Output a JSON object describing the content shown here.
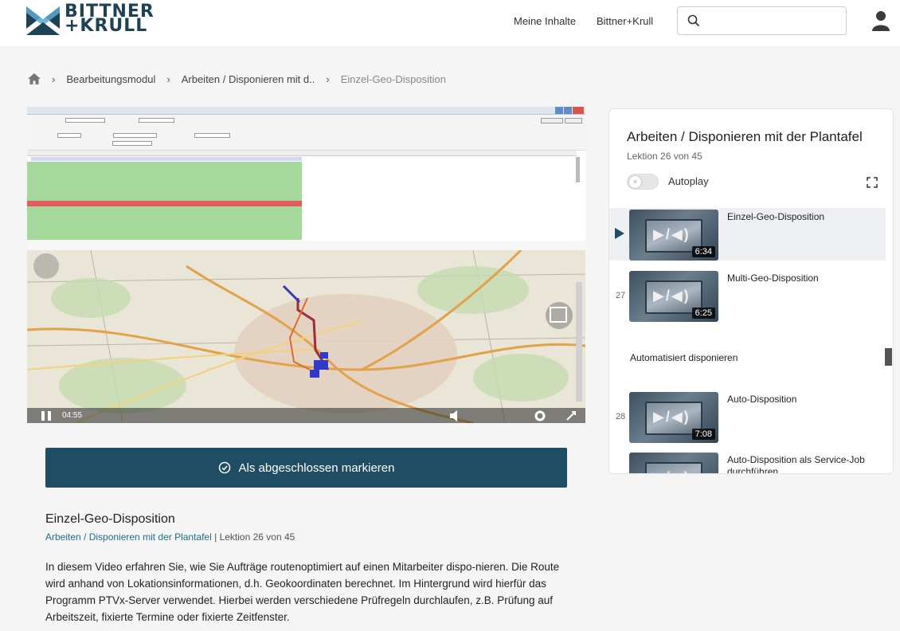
{
  "brand": {
    "line1": "BITTNER",
    "line2": "+KRULL"
  },
  "nav": {
    "link1": "Meine Inhalte",
    "link2": "Bittner+Krull"
  },
  "search": {
    "placeholder": ""
  },
  "breadcrumb": {
    "items": [
      "Bearbeitungsmodul",
      "Arbeiten / Disponieren mit d..",
      "Einzel-Geo-Disposition"
    ]
  },
  "video": {
    "current_time": "04:55"
  },
  "complete_button": {
    "label": "Als abgeschlossen markieren"
  },
  "info": {
    "title": "Einzel-Geo-Disposition",
    "course_link": "Arbeiten / Disponieren mit der Plantafel",
    "lesson": "Lektion 26 von 45",
    "description": "In diesem Video erfahren Sie, wie Sie Aufträge routenoptimiert auf einen Mitarbeiter dispo-nieren. Die Route wird anhand von Lokationsinformationen, d.h. Geokoordinaten berechnet. Im Hintergrund wird hierfür das Programm PTVx-Server verwendet. Hierbei werden verschiedene Prüfregeln durchlaufen, z.B. Prüfung auf Arbeitszeit, fixierte Termine oder fixierte Zeitfenster."
  },
  "panel": {
    "title": "Arbeiten / Disponieren mit der Plantafel",
    "lesson": "Lektion 26 von 45",
    "autoplay_label": "Autoplay",
    "toggle_mark": "×",
    "items": [
      {
        "num": "",
        "title": "Einzel-Geo-Disposition",
        "duration": "6:34",
        "active": true
      },
      {
        "num": "27",
        "title": "Multi-Geo-Disposition",
        "duration": "6:25",
        "active": false
      },
      {
        "num": "28",
        "title": "Auto-Disposition",
        "duration": "7:08",
        "active": false
      },
      {
        "num": "",
        "title": "Auto-Disposition als Service-Job durchführen",
        "duration": "",
        "active": false
      }
    ],
    "section_label": "Automatisiert disponieren"
  },
  "colors": {
    "primary": "#1f4d64",
    "link": "#1f6d8a",
    "route": "#9b2d3c"
  },
  "icons": {
    "home": "home-icon",
    "search": "search-icon",
    "user": "user-icon",
    "check": "check-circle-icon",
    "expand": "expand-icon"
  }
}
